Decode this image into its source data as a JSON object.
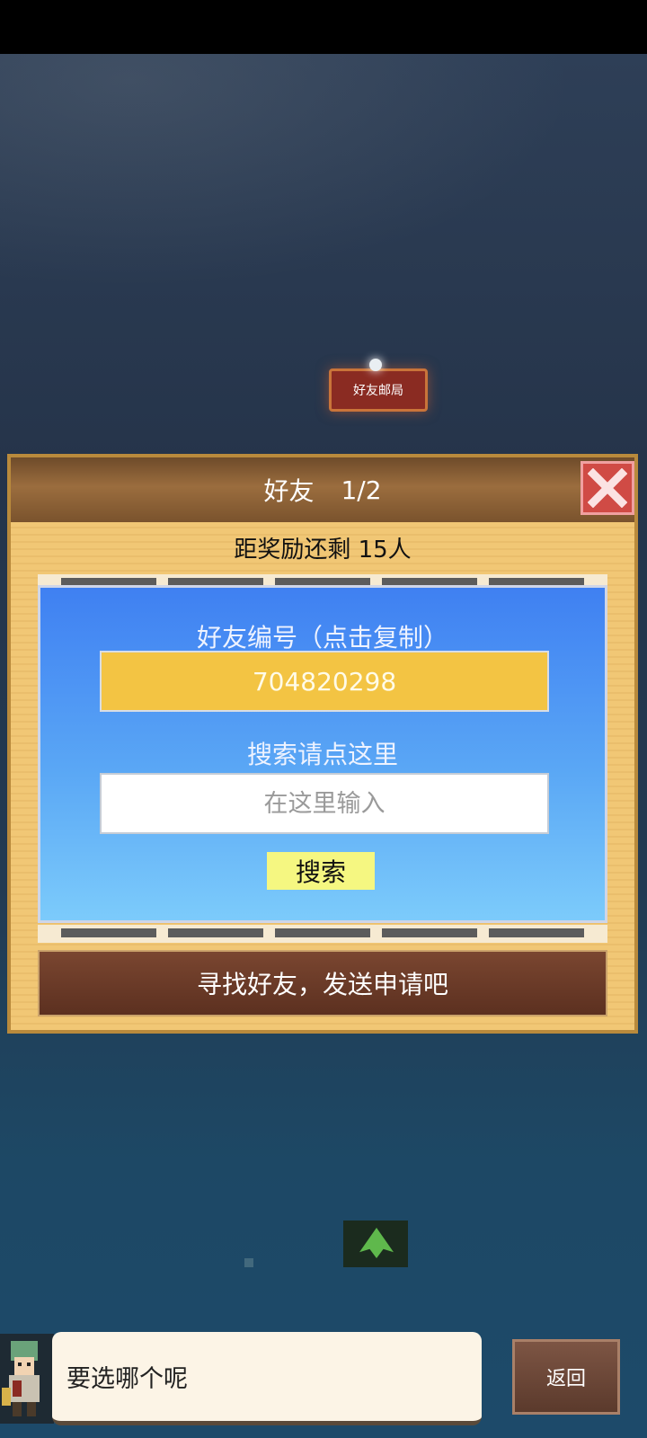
{
  "map": {
    "building_label": "好友邮局"
  },
  "dialog": {
    "title": "好友",
    "page": "1/2",
    "subtitle": "距奖励还剩 15人",
    "friend_id_label": "好友编号（点击复制）",
    "friend_id": "704820298",
    "search_label": "搜索请点这里",
    "search_placeholder": "在这里输入",
    "search_button": "搜索",
    "hint": "寻找好友，发送申请吧"
  },
  "bottom": {
    "speech_text": "要选哪个呢",
    "back_button": "返回"
  },
  "colors": {
    "panel_bg": "#f1c775",
    "header_brown": "#7a532d",
    "blue_box": "#4a8ff3",
    "id_yellow": "#f3c443",
    "search_button": "#f5f781",
    "close_red": "#d04b45",
    "arrow": "#cfe34a"
  }
}
